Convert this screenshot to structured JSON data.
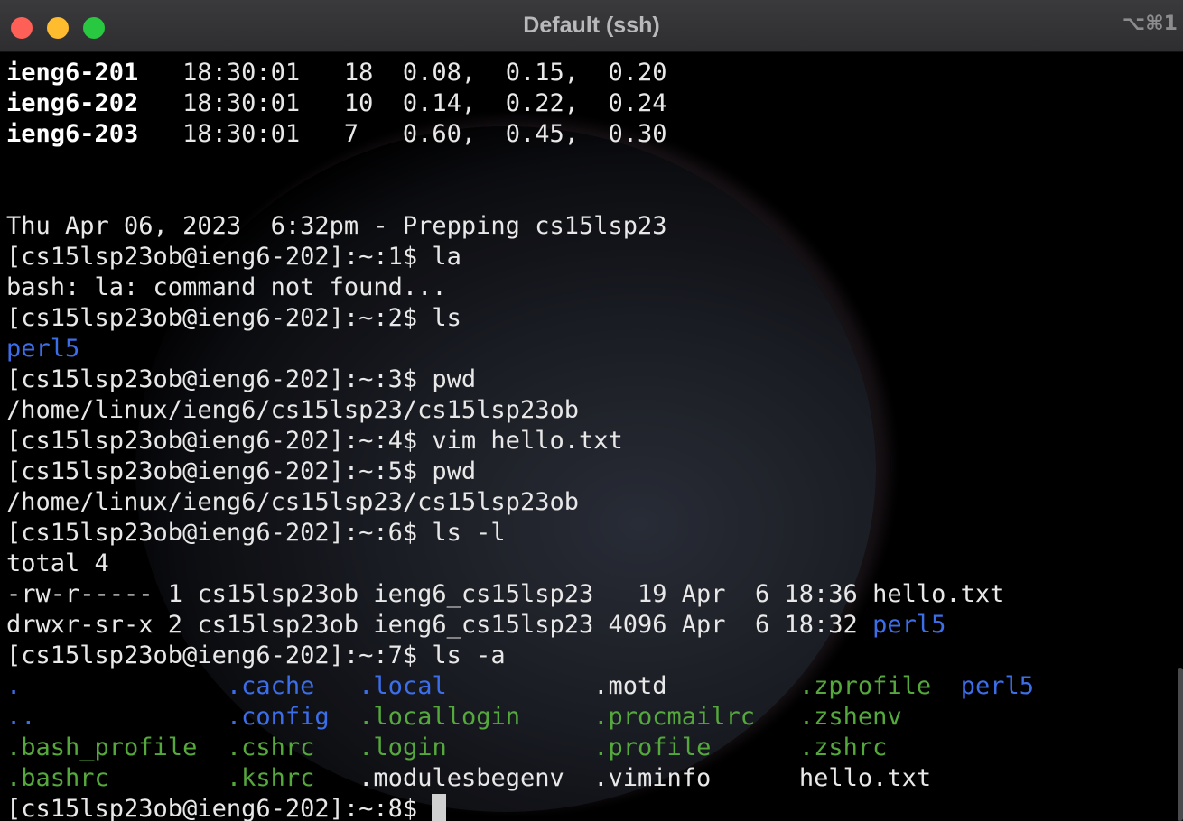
{
  "window": {
    "title": "Default (ssh)",
    "shortcut": "⌥⌘1"
  },
  "terminal": {
    "load": [
      {
        "host": "ieng6-201",
        "rest": "   18:30:01   18  0.08,  0.15,  0.20"
      },
      {
        "host": "ieng6-202",
        "rest": "   18:30:01   10  0.14,  0.22,  0.24"
      },
      {
        "host": "ieng6-203",
        "rest": "   18:30:01   7   0.60,  0.45,  0.30"
      }
    ],
    "banner": "Thu Apr 06, 2023  6:32pm - Prepping cs15lsp23",
    "l_p1": "[cs15lsp23ob@ieng6-202]:~:1$ la",
    "l_err": "bash: la: command not found...",
    "l_p2": "[cs15lsp23ob@ieng6-202]:~:2$ ls",
    "l_perl5": "perl5",
    "l_p3": "[cs15lsp23ob@ieng6-202]:~:3$ pwd",
    "l_pwd1": "/home/linux/ieng6/cs15lsp23/cs15lsp23ob",
    "l_p4": "[cs15lsp23ob@ieng6-202]:~:4$ vim hello.txt",
    "l_p5": "[cs15lsp23ob@ieng6-202]:~:5$ pwd",
    "l_pwd2": "/home/linux/ieng6/cs15lsp23/cs15lsp23ob",
    "l_p6": "[cs15lsp23ob@ieng6-202]:~:6$ ls -l",
    "l_total": "total 4",
    "l_file1": "-rw-r----- 1 cs15lsp23ob ieng6_cs15lsp23   19 Apr  6 18:36 hello.txt",
    "l_dir1_prefix": "drwxr-sr-x 2 cs15lsp23ob ieng6_cs15lsp23 4096 Apr  6 18:32 ",
    "l_dir1_name": "perl5",
    "l_p7": "[cs15lsp23ob@ieng6-202]:~:7$ ls -a",
    "la": {
      "r1": [
        ".",
        "              ",
        ".cache",
        "   ",
        ".local",
        "          ",
        ".motd",
        "         ",
        ".zprofile",
        "  ",
        "perl5"
      ],
      "r2": [
        "..",
        "             ",
        ".config",
        "  ",
        ".locallogin",
        "     ",
        ".procmailrc",
        "   ",
        ".zshenv"
      ],
      "r3": [
        ".bash_profile",
        "  ",
        ".cshrc",
        "   ",
        ".login",
        "          ",
        ".profile",
        "      ",
        ".zshrc"
      ],
      "r4": [
        ".bashrc",
        "        ",
        ".kshrc",
        "   ",
        ".modulesbegenv",
        "  ",
        ".viminfo",
        "      ",
        "hello.txt"
      ]
    },
    "prompt_final": "[cs15lsp23ob@ieng6-202]:~:8$ "
  }
}
